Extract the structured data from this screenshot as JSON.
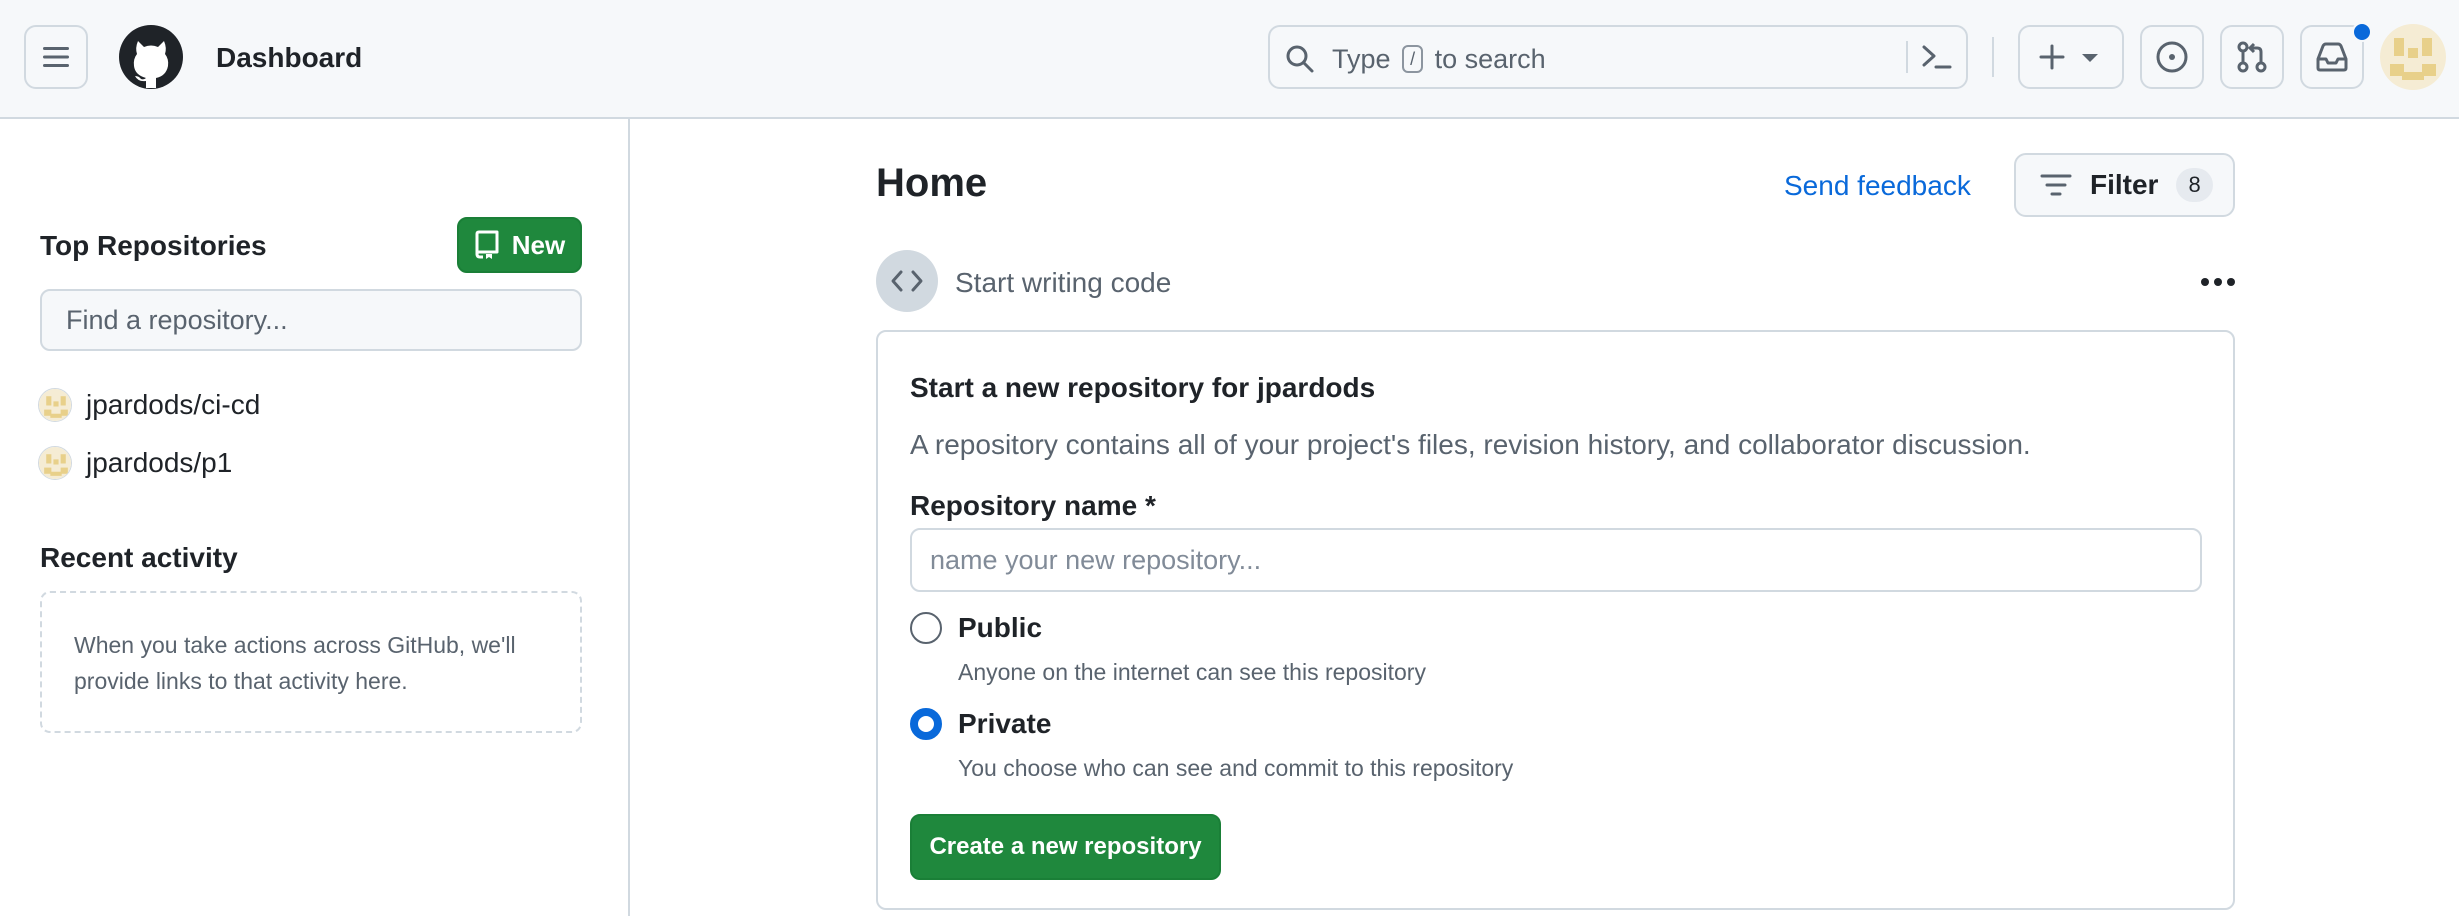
{
  "header": {
    "title": "Dashboard",
    "search": {
      "prefix": "Type",
      "key": "/",
      "suffix": "to search"
    }
  },
  "sidebar": {
    "top_repos_title": "Top Repositories",
    "new_button": "New",
    "find_placeholder": "Find a repository...",
    "repos": [
      {
        "name": "jpardods/ci-cd"
      },
      {
        "name": "jpardods/p1"
      }
    ],
    "recent_title": "Recent activity",
    "recent_empty": "When you take actions across GitHub, we'll provide links to that activity here."
  },
  "main": {
    "title": "Home",
    "send_feedback": "Send feedback",
    "filter_label": "Filter",
    "filter_count": "8",
    "start_writing": "Start writing code",
    "card": {
      "title": "Start a new repository for jpardods",
      "description": "A repository contains all of your project's files, revision history, and collaborator discussion.",
      "repo_name_label": "Repository name *",
      "repo_name_placeholder": "name your new repository...",
      "visibility": [
        {
          "label": "Public",
          "description": "Anyone on the internet can see this repository",
          "selected": false
        },
        {
          "label": "Private",
          "description": "You choose who can see and commit to this repository",
          "selected": true
        }
      ],
      "create_button": "Create a new repository"
    }
  },
  "colors": {
    "primary_green": "#1f883d",
    "link_blue": "#0969da",
    "border": "#d1d9e0",
    "header_bg": "#f6f8fa"
  }
}
